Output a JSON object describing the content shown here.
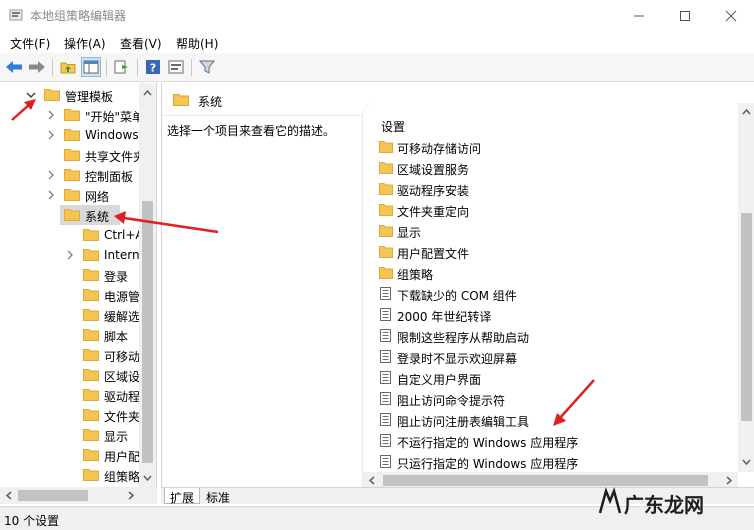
{
  "window": {
    "title": "本地组策略编辑器"
  },
  "menu": [
    "文件(F)",
    "操作(A)",
    "查看(V)",
    "帮助(H)"
  ],
  "toolbar": {
    "icons": [
      "back-arrow-icon",
      "forward-arrow-icon",
      "up-folder-icon",
      "show-hide-tree-icon",
      "export-list-icon",
      "help-icon",
      "properties-icon",
      "filter-icon"
    ]
  },
  "tree": [
    {
      "label": "管理模板",
      "expand": "open"
    },
    {
      "label": "\"开始\"菜单",
      "expand": "closed"
    },
    {
      "label": "Windows",
      "expand": "closed"
    },
    {
      "label": "共享文件夹",
      "expand": "none"
    },
    {
      "label": "控制面板",
      "expand": "closed"
    },
    {
      "label": "网络",
      "expand": "closed"
    },
    {
      "label": "系统",
      "expand": "open",
      "selected": true
    },
    {
      "label": "Ctrl+Alt",
      "expand": "none"
    },
    {
      "label": "Internet",
      "expand": "closed"
    },
    {
      "label": "登录",
      "expand": "none"
    },
    {
      "label": "电源管理",
      "expand": "none"
    },
    {
      "label": "缓解选项",
      "expand": "none"
    },
    {
      "label": "脚本",
      "expand": "none"
    },
    {
      "label": "可移动存储",
      "expand": "none"
    },
    {
      "label": "区域设置",
      "expand": "none"
    },
    {
      "label": "驱动程序",
      "expand": "none"
    },
    {
      "label": "文件夹重",
      "expand": "none"
    },
    {
      "label": "显示",
      "expand": "none"
    },
    {
      "label": "用户配置",
      "expand": "none"
    },
    {
      "label": "组策略",
      "expand": "none"
    }
  ],
  "content": {
    "header": "系统",
    "description": "选择一个项目来查看它的描述。",
    "column_header": "设置",
    "items": [
      {
        "label": "可移动存储访问",
        "type": "folder"
      },
      {
        "label": "区域设置服务",
        "type": "folder"
      },
      {
        "label": "驱动程序安装",
        "type": "folder"
      },
      {
        "label": "文件夹重定向",
        "type": "folder"
      },
      {
        "label": "显示",
        "type": "folder"
      },
      {
        "label": "用户配置文件",
        "type": "folder"
      },
      {
        "label": "组策略",
        "type": "folder"
      },
      {
        "label": "下载缺少的 COM 组件",
        "type": "setting"
      },
      {
        "label": "2000 年世纪转译",
        "type": "setting"
      },
      {
        "label": "限制这些程序从帮助启动",
        "type": "setting"
      },
      {
        "label": "登录时不显示欢迎屏幕",
        "type": "setting"
      },
      {
        "label": "自定义用户界面",
        "type": "setting"
      },
      {
        "label": "阻止访问命令提示符",
        "type": "setting"
      },
      {
        "label": "阻止访问注册表编辑工具",
        "type": "setting"
      },
      {
        "label": "不运行指定的 Windows 应用程序",
        "type": "setting"
      },
      {
        "label": "只运行指定的 Windows 应用程序",
        "type": "setting"
      }
    ]
  },
  "tabs": [
    "扩展",
    "标准"
  ],
  "status": "10 个设置",
  "watermark": "广东龙网",
  "colors": {
    "folder": "#f5c451",
    "folder_dark": "#e0a93a",
    "accent_blue": "#2f7bd6",
    "annotation_red": "#e02020"
  }
}
